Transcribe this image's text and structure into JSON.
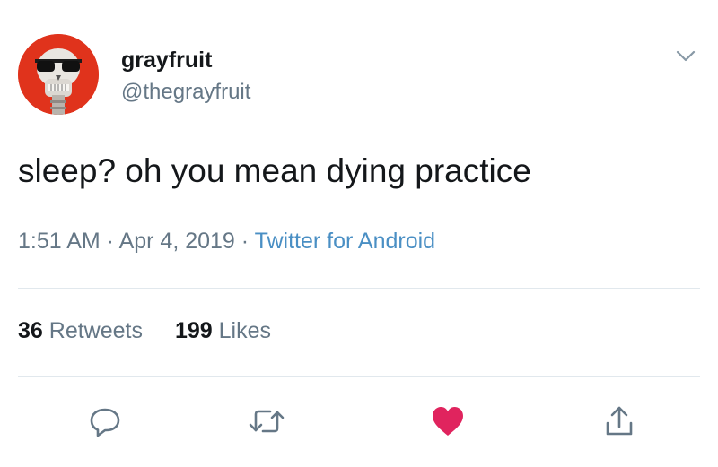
{
  "user": {
    "display_name": "grayfruit",
    "handle": "@thegrayfruit",
    "avatar_icon": "skull-with-sunglasses-avatar",
    "avatar_bg": "#e0331c"
  },
  "tweet": {
    "text": "sleep? oh you mean dying practice",
    "time": "1:51 AM",
    "date": "Apr 4, 2019",
    "source": "Twitter for Android",
    "separator": " · "
  },
  "stats": {
    "retweets_count": "36",
    "retweets_label": "Retweets",
    "likes_count": "199",
    "likes_label": "Likes"
  },
  "actions": [
    {
      "icon": "reply-icon"
    },
    {
      "icon": "retweet-icon"
    },
    {
      "icon": "heart-icon",
      "color": "#e0245e",
      "active": true
    },
    {
      "icon": "share-icon"
    }
  ],
  "menu": {
    "icon": "chevron-down-icon"
  },
  "colors": {
    "text_primary": "#14171a",
    "text_secondary": "#657786",
    "link": "#4a8fc4",
    "like": "#e0245e",
    "divider": "#e1e8ed"
  }
}
